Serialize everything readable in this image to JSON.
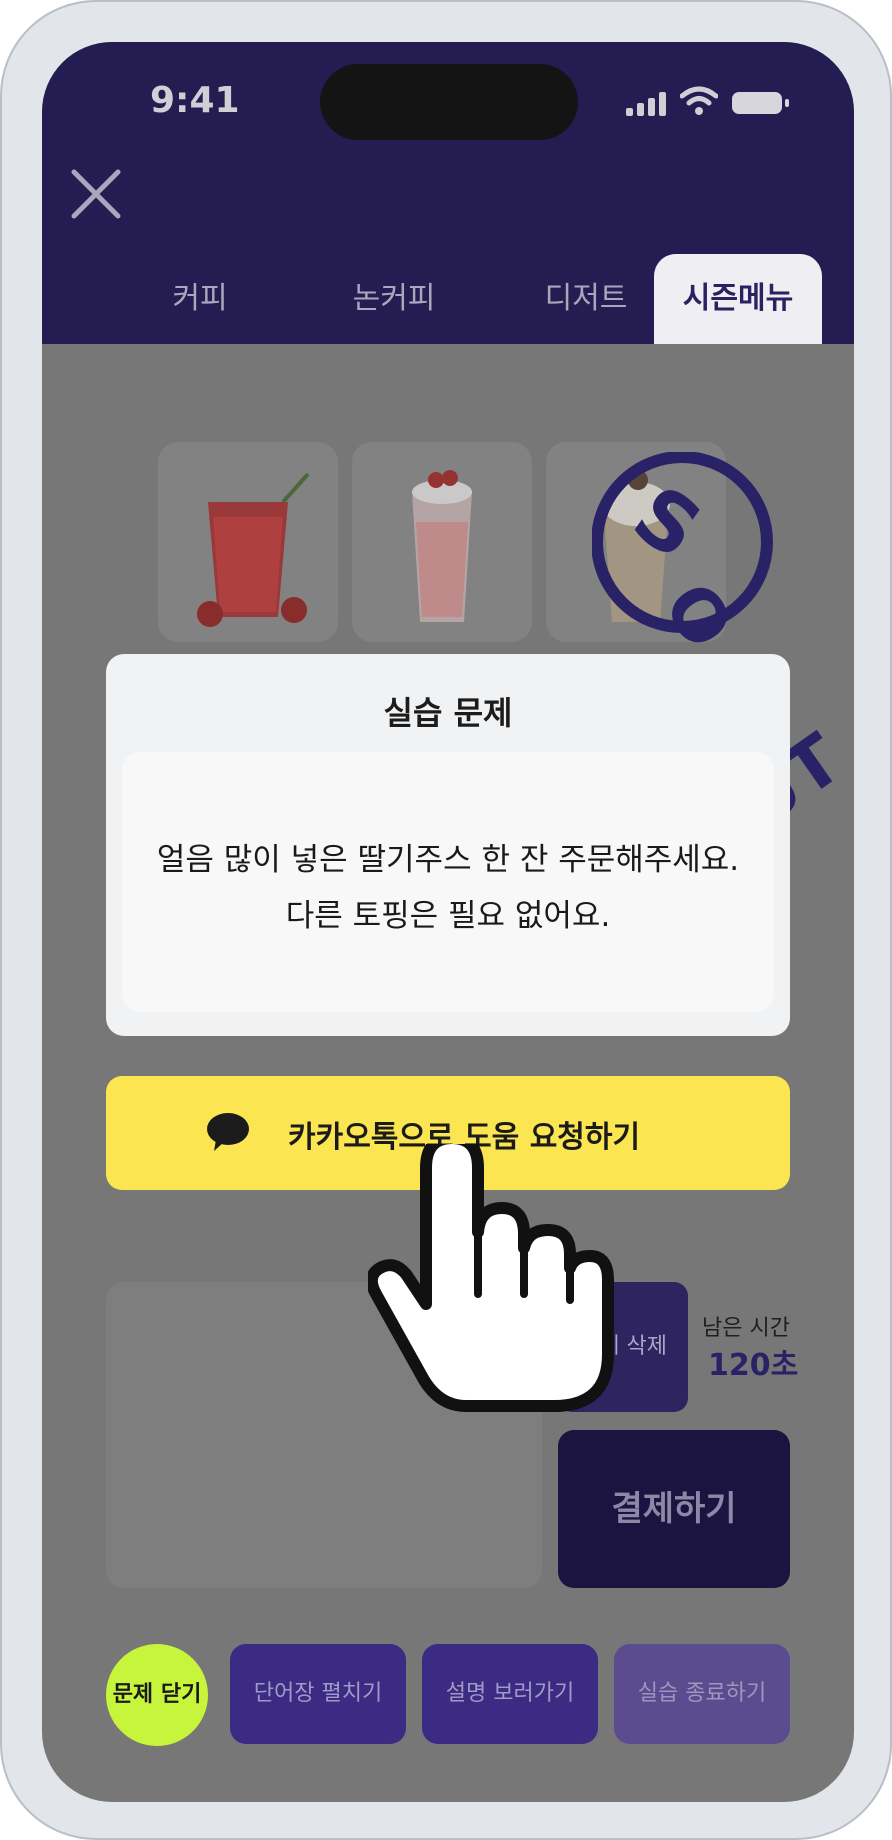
{
  "status": {
    "time": "9:41"
  },
  "tabs": [
    {
      "label": "커피",
      "active": false
    },
    {
      "label": "논커피",
      "active": false
    },
    {
      "label": "디저트",
      "active": false
    },
    {
      "label": "시즌메뉴",
      "active": true
    }
  ],
  "products": [
    {
      "name": "strawberry-juice",
      "image": "strawberry-juice"
    },
    {
      "name": "strawberry-latte",
      "image": "strawberry-latte"
    },
    {
      "name": "season-drink",
      "image": "cream-drink"
    }
  ],
  "stamp": {
    "text": "SOLD OUT"
  },
  "dialog": {
    "title": "실습 문제",
    "line1": "얼음 많이 넣은 딸기주스 한 잔 주문해주세요.",
    "line2": "다른 토핑은 필요 없어요."
  },
  "kakao": {
    "label": "카카오톡으로 도움 요청하기"
  },
  "cart": {
    "clear_label": "전체 삭제",
    "time_label": "남은 시간",
    "time_value": "120초",
    "pay_label": "결제하기"
  },
  "bottom_bar": {
    "close_problem": "문제 닫기",
    "vocab": "단어장 펼치기",
    "guide": "설명 보러가기",
    "end": "실습 종료하기"
  },
  "colors": {
    "header": "#251d52",
    "kakao_yellow": "#fbe651",
    "close_green": "#c7f53b",
    "overlay_gray": "#7a7a7a"
  }
}
